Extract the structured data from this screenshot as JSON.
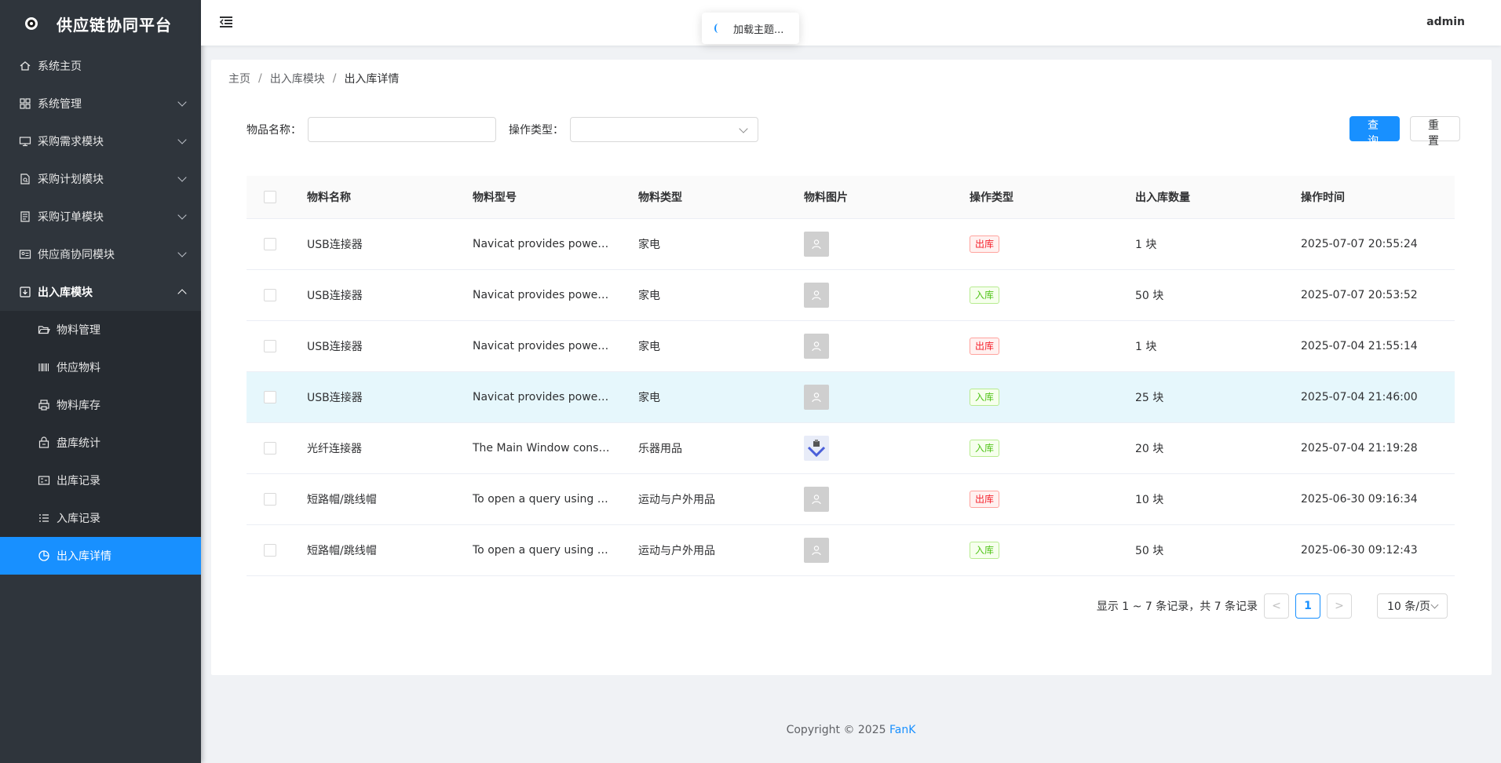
{
  "app": {
    "title": "供应链协同平台",
    "user": "admin"
  },
  "toast": {
    "text": "加载主题..."
  },
  "sidebar": {
    "items": [
      {
        "label": "系统主页",
        "icon": "home-icon",
        "has_children": false
      },
      {
        "label": "系统管理",
        "icon": "grid-icon",
        "has_children": true
      },
      {
        "label": "采购需求模块",
        "icon": "monitor-icon",
        "has_children": true
      },
      {
        "label": "采购计划模块",
        "icon": "doc-search-icon",
        "has_children": true
      },
      {
        "label": "采购订单模块",
        "icon": "doc-list-icon",
        "has_children": true
      },
      {
        "label": "供应商协同模块",
        "icon": "id-card-icon",
        "has_children": true
      },
      {
        "label": "出入库模块",
        "icon": "download-box-icon",
        "has_children": true,
        "open": true
      }
    ],
    "sub_items": [
      {
        "label": "物料管理",
        "icon": "folder-open-icon"
      },
      {
        "label": "供应物料",
        "icon": "barcode-icon"
      },
      {
        "label": "物料库存",
        "icon": "printer-icon"
      },
      {
        "label": "盘库统计",
        "icon": "lock-box-icon"
      },
      {
        "label": "出库记录",
        "icon": "list-out-icon"
      },
      {
        "label": "入库记录",
        "icon": "list-in-icon"
      },
      {
        "label": "出入库详情",
        "icon": "pie-chart-icon",
        "active": true
      }
    ]
  },
  "breadcrumb": {
    "items": [
      "主页",
      "出入库模块",
      "出入库详情"
    ]
  },
  "search": {
    "name_label": "物品名称：",
    "name_value": "",
    "type_label": "操作类型：",
    "type_value": "",
    "query_btn": "查询",
    "reset_btn": "重置"
  },
  "table": {
    "columns": [
      "物料名称",
      "物料型号",
      "物料类型",
      "物料图片",
      "操作类型",
      "出入库数量",
      "操作时间"
    ],
    "rows": [
      {
        "name": "USB连接器",
        "model": "Navicat provides powerful tools for working with databases",
        "type": "家电",
        "image": "avatar-placeholder",
        "op": "出库",
        "qty": "1 块",
        "time": "2025-07-07 20:55:24"
      },
      {
        "name": "USB连接器",
        "model": "Navicat provides powerful tools for working with databases",
        "type": "家电",
        "image": "avatar-placeholder",
        "op": "入库",
        "qty": "50 块",
        "time": "2025-07-07 20:53:52"
      },
      {
        "name": "USB连接器",
        "model": "Navicat provides powerful tools for working with databases",
        "type": "家电",
        "image": "avatar-placeholder",
        "op": "出库",
        "qty": "1 块",
        "time": "2025-07-04 21:55:14"
      },
      {
        "name": "USB连接器",
        "model": "Navicat provides powerful tools for working with databases",
        "type": "家电",
        "image": "avatar-placeholder",
        "op": "入库",
        "qty": "25 块",
        "time": "2025-07-04 21:46:00",
        "highlight": true
      },
      {
        "name": "光纤连接器",
        "model": "The Main Window consists of several toolbars and panes",
        "type": "乐器用品",
        "image": "product-image",
        "op": "入库",
        "qty": "20 块",
        "time": "2025-07-04 21:19:28"
      },
      {
        "name": "短路帽/跳线帽",
        "model": "To open a query using an external editor",
        "type": "运动与户外用品",
        "image": "avatar-placeholder",
        "op": "出库",
        "qty": "10 块",
        "time": "2025-06-30 09:16:34"
      },
      {
        "name": "短路帽/跳线帽",
        "model": "To open a query using an external editor",
        "type": "运动与户外用品",
        "image": "avatar-placeholder",
        "op": "入库",
        "qty": "50 块",
        "time": "2025-06-30 09:12:43"
      }
    ]
  },
  "pagination": {
    "summary": "显示 1 ~ 7 条记录，共 7 条记录",
    "prev": "<",
    "current": "1",
    "next": ">",
    "page_size": "10 条/页"
  },
  "footer": {
    "text": "Copyright © 2025 ",
    "brand": "FanK"
  },
  "colors": {
    "primary": "#1890ff",
    "sidebar": "#2f353c",
    "out_tag": "#f5222d",
    "in_tag": "#52c41a",
    "highlight_row": "#e6f7fc"
  }
}
